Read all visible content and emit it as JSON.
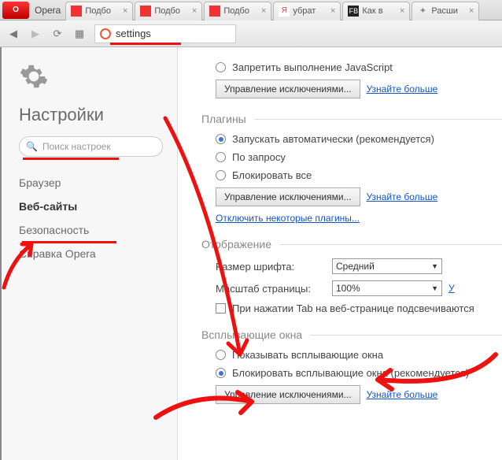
{
  "titlebar": {
    "opera": "O",
    "opera_label": "Opera"
  },
  "tabs": [
    {
      "label": "Подбо"
    },
    {
      "label": "Подбо"
    },
    {
      "label": "Подбо"
    },
    {
      "label": "убрат"
    },
    {
      "label": "Как в"
    },
    {
      "label": "Расши"
    }
  ],
  "address": {
    "value": "settings"
  },
  "sidebar": {
    "title": "Настройки",
    "search_placeholder": "Поиск настроек",
    "items": [
      {
        "label": "Браузер"
      },
      {
        "label": "Веб-сайты"
      },
      {
        "label": "Безопасность"
      },
      {
        "label": "Справка Opera"
      }
    ]
  },
  "sections": {
    "js": {
      "disable": "Запретить выполнение JavaScript",
      "exceptions": "Управление исключениями...",
      "learn": "Узнайте больше"
    },
    "plugins": {
      "title": "Плагины",
      "auto": "Запускать автоматически (рекомендуется)",
      "ondemand": "По запросу",
      "block": "Блокировать все",
      "exceptions": "Управление исключениями...",
      "learn": "Узнайте больше",
      "disable_some": "Отключить некоторые плагины..."
    },
    "display": {
      "title": "Отображение",
      "font_label": "Размер шрифта:",
      "font_value": "Средний",
      "zoom_label": "Масштаб страницы:",
      "zoom_value": "100%",
      "zoom_learn": "У",
      "tab_highlight": "При нажатии Tab на веб-странице подсвечиваются"
    },
    "popups": {
      "title": "Всплывающие окна",
      "show": "Показывать всплывающие окна",
      "block": "Блокировать всплывающие окна (рекомендуется)",
      "exceptions": "Управление исключениями...",
      "learn": "Узнайте больше"
    }
  }
}
